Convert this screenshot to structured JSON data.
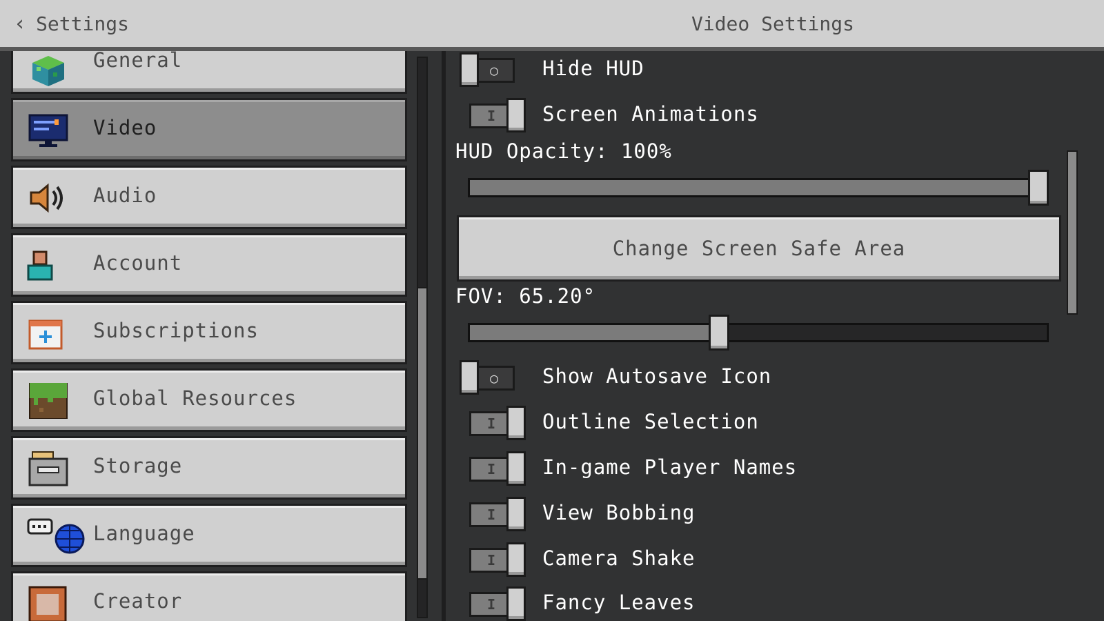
{
  "header": {
    "back_label": "Settings",
    "title": "Video Settings"
  },
  "sidebar": {
    "items": [
      {
        "label": "General",
        "icon": "cube-icon",
        "active": false
      },
      {
        "label": "Video",
        "icon": "monitor-icon",
        "active": true
      },
      {
        "label": "Audio",
        "icon": "speaker-icon",
        "active": false
      },
      {
        "label": "Account",
        "icon": "account-icon",
        "active": false
      },
      {
        "label": "Subscriptions",
        "icon": "calendar-plus-icon",
        "active": false
      },
      {
        "label": "Global Resources",
        "icon": "grass-block-icon",
        "active": false
      },
      {
        "label": "Storage",
        "icon": "storage-box-icon",
        "active": false
      },
      {
        "label": "Language",
        "icon": "globe-chat-icon",
        "active": false
      },
      {
        "label": "Creator",
        "icon": "creator-icon",
        "active": false
      }
    ]
  },
  "settings": {
    "hide_hud": {
      "label": "Hide HUD",
      "on": false
    },
    "screen_animations": {
      "label": "Screen Animations",
      "on": true
    },
    "hud_opacity": {
      "label": "HUD Opacity: 100%",
      "value": 1.0
    },
    "safe_area_button": "Change Screen Safe Area",
    "fov": {
      "label": "FOV: 65.20°",
      "value": 0.43
    },
    "show_autosave_icon": {
      "label": "Show Autosave Icon",
      "on": false
    },
    "outline_selection": {
      "label": "Outline Selection",
      "on": true
    },
    "player_names": {
      "label": "In-game Player Names",
      "on": true
    },
    "view_bobbing": {
      "label": "View Bobbing",
      "on": true
    },
    "camera_shake": {
      "label": "Camera Shake",
      "on": true
    },
    "fancy_leaves": {
      "label": "Fancy Leaves",
      "on": true
    }
  },
  "colors": {
    "panel": "#313233",
    "button": "#d0d0d0",
    "active_button": "#8d8d8d",
    "text_light": "#ffffff",
    "text_dark": "#4a4a4a"
  }
}
